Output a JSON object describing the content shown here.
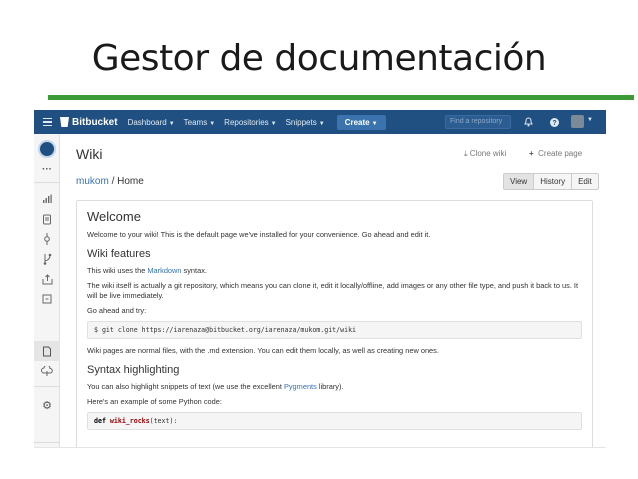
{
  "slide": {
    "title": "Gestor de documentación"
  },
  "topbar": {
    "brand": "Bitbucket",
    "nav": [
      "Dashboard",
      "Teams",
      "Repositories",
      "Snippets"
    ],
    "create_label": "Create",
    "search_placeholder": "Find a repository",
    "icons": [
      "menu-icon",
      "bucket-logo-icon",
      "caret-down-icon",
      "notification-icon",
      "help-icon",
      "avatar"
    ]
  },
  "sidebar": {
    "icons": [
      "repo-avatar",
      "more-icon",
      "overview-icon",
      "source-icon",
      "commits-icon",
      "branches-icon",
      "pull-requests-icon",
      "downloads-icon",
      "wiki-icon",
      "pipelines-icon",
      "settings-icon"
    ]
  },
  "page": {
    "title": "Wiki",
    "clone_wiki": "Clone wiki",
    "create_page": "Create page",
    "breadcrumb_owner": "mukom",
    "breadcrumb_sep": " / ",
    "breadcrumb_page": "Home",
    "view_buttons": [
      "View",
      "History",
      "Edit"
    ]
  },
  "wiki": {
    "welcome_heading": "Welcome",
    "welcome_text": "Welcome to your wiki! This is the default page we've installed for your convenience. Go ahead and edit it.",
    "features_heading": "Wiki features",
    "features_text_pre": "This wiki uses the ",
    "features_link": "Markdown",
    "features_text_post": " syntax.",
    "repo_text": "The wiki itself is actually a git repository, which means you can clone it, edit it locally/offline, add images or any other file type, and push it back to us. It will be live immediately.",
    "try_text": "Go ahead and try:",
    "clone_cmd": "$ git clone https://iarenaza@bitbucket.org/iarenaza/mukom.git/wiki",
    "files_text": "Wiki pages are normal files, with the .md extension. You can edit them locally, as well as creating new ones.",
    "syntax_heading": "Syntax highlighting",
    "syntax_text_pre": "You can also highlight snippets of text (we use the excellent ",
    "syntax_link": "Pygments",
    "syntax_text_post": " library).",
    "example_text": "Here's an example of some Python code:",
    "code_kw": "def",
    "code_fn": "wiki_rocks",
    "code_rest": "(text):"
  },
  "colors": {
    "topbar": "#205081",
    "link": "#3572b0",
    "rule": "#3d9b37"
  }
}
